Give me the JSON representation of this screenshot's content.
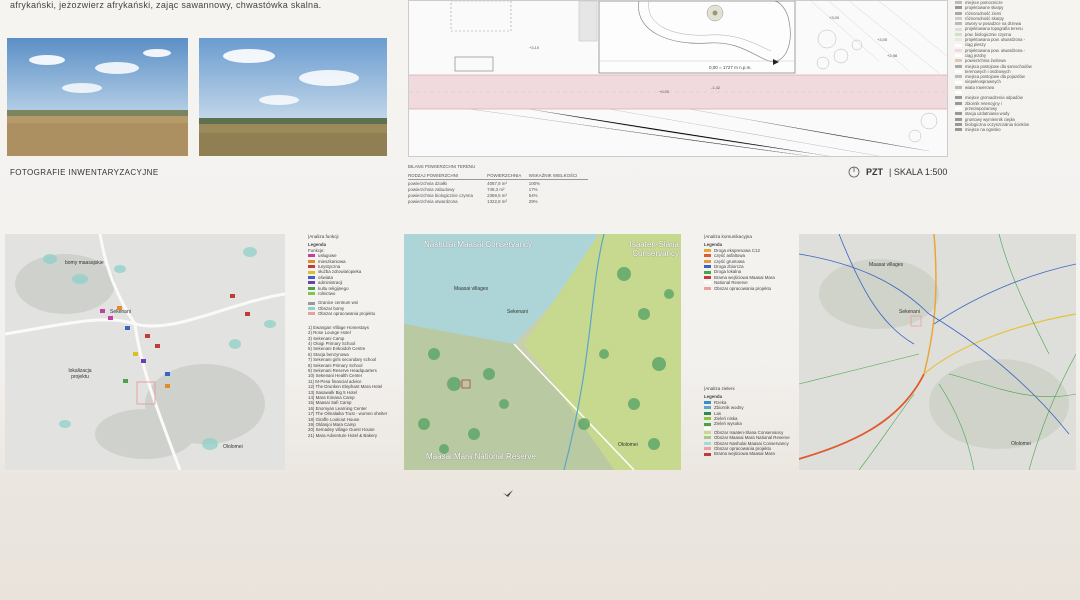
{
  "intro_text": "afrykański, jeżozwierz afrykański, zając sawannowy, chwastówka skalna.",
  "photos_caption": "FOTOGRAFIE INWENTARYZACYJNE",
  "plan_annotations": {
    "level_label": "0,00 = 1727 m n.p.m.",
    "dims": [
      "+3,05",
      "+2,98",
      "+3,00",
      "+3,10",
      "-1,42",
      "+0,00"
    ]
  },
  "legend_top": [
    {
      "label": "miejsce pomocnicze",
      "color": "#bbbbbb"
    },
    {
      "label": "projektowane skarpy",
      "color": "#999999"
    },
    {
      "label": "różnorodność ziemi",
      "color": "#aaaaaa"
    },
    {
      "label": "różnorodność skarpy",
      "color": "#cccccc"
    },
    {
      "label": "otwory w posadzce na drzewa",
      "color": "#bbbbbb"
    },
    {
      "label": "projektowana topografia terenu",
      "color": "#dddddd"
    },
    {
      "label": "pow. biologicznie czynna",
      "color": "#cfe3c4"
    },
    {
      "label": "projektowana pow. utwardzona -",
      "color": "#e6e6e6"
    },
    {
      "label": "ciąg pieszy",
      "color": "#ffffff"
    },
    {
      "label": "projektowana pow. utwardzona -",
      "color": "#f0d8dc"
    },
    {
      "label": "ciąg jezdny",
      "color": "#ffffff"
    },
    {
      "label": "powierzchnia żwirowa",
      "color": "#d9c9b8"
    },
    {
      "label": "miejsca postojowe dla samochodów",
      "color": "#aaaaaa"
    },
    {
      "label": "terenowych i osobowych",
      "color": "#ffffff"
    },
    {
      "label": "miejsca postojowe dla pojazdów",
      "color": "#bbbbbb"
    },
    {
      "label": "niepełnosprawnych",
      "color": "#ffffff"
    },
    {
      "label": "wiata rowerowa",
      "color": "#bbbbbb"
    },
    {
      "label": "",
      "color": "#ffffff"
    },
    {
      "label": "miejsce gromadzenia odpadów",
      "color": "#999999"
    },
    {
      "label": "zbiornik retencyjny i",
      "color": "#999999"
    },
    {
      "label": "przeciwpożarowy",
      "color": "#ffffff"
    },
    {
      "label": "stacja uzdatniania wody",
      "color": "#999999"
    },
    {
      "label": "gruntowy wymiennik ciepła",
      "color": "#999999"
    },
    {
      "label": "biologiczna oczyszczalnia ścieków",
      "color": "#999999"
    },
    {
      "label": "miejsce na ognisko",
      "color": "#999999"
    }
  ],
  "balance": {
    "title": "BILANS POWIERZCHNI TERENU",
    "headers": [
      "RODZAJ POWIERZCHNI",
      "POWIERZCHNIA",
      "WSKAŹNIK WIELKOŚCI"
    ],
    "rows": [
      [
        "powierzchnia działki",
        "4087,8 m²",
        "100%"
      ],
      [
        "powierzchnia zabudowy",
        "749,3 m²",
        "17%"
      ],
      [
        "powierzchnia biologicznie czynna",
        "2369,5 m²",
        "54%"
      ],
      [
        "powierzchnia utwardzona",
        "1322,8 m²",
        "29%"
      ]
    ]
  },
  "scale": {
    "code": "PZT",
    "text": "| SKALA 1:500"
  },
  "analysis_functions": {
    "title": "|Analiza funkcji",
    "legend_header": "Legenda",
    "functions_label": "Funkcje:",
    "items": [
      {
        "label": "usługowe",
        "color": "#c43fa3"
      },
      {
        "label": "mieszkaniowa",
        "color": "#e08c2b"
      },
      {
        "label": "turystyczna",
        "color": "#c23b3b"
      },
      {
        "label": "służba zdrowia/opieka",
        "color": "#d9c125"
      },
      {
        "label": "oświata",
        "color": "#3b64c2"
      },
      {
        "label": "administracji",
        "color": "#6b3fb0"
      },
      {
        "label": "kultu religijnego",
        "color": "#4aa34a"
      },
      {
        "label": "rolnictwo",
        "color": "#8bc34a"
      }
    ],
    "extra": [
      {
        "label": "Granice centrum wsi",
        "color": "#999999"
      },
      {
        "label": "Obszar bomy",
        "color": "#8fd0c8"
      },
      {
        "label": "Obszar opracowania projektu",
        "color": "#e8a0a0"
      }
    ],
    "places": [
      "1) Ewangan Village Homestays",
      "2) Rose Lounge Hotel",
      "3) Sekenani Camp",
      "4) Oloigi Primary School",
      "5) Sekenani Enkoidoh Centre",
      "6) Stacja benzynowa",
      "7) Sekenani girls secondary school",
      "8) Sekenani Primary School",
      "9) Sekenani Reserve Headquarters",
      "10) Sekenani Health Center",
      "11) M-Pesa financial advice",
      "12) The Drunken Elephant Mara Hotel",
      "13) Sasawalk Big 5 Hotel",
      "14) Mara Kimana Camp",
      "15) Maasai Safi Camp",
      "16) Enomyan Learning Center",
      "17) The Olmalaika Trust - women shelter",
      "18) Giraffe Lookout House",
      "19) Oldanjoi Mara Camp",
      "20) Semadey village Guest House",
      "21) Mara Adventure Hotel & Bakery"
    ]
  },
  "map1_labels": {
    "bomas": "bomy maasajskie",
    "town": "Sekenani",
    "location": "lokalizacja projektu",
    "ololomei": "Ololomei"
  },
  "map2_labels": {
    "north": "Nashulai Maasai Conservancy",
    "east": "Isaaten-Slana Conservancy",
    "south": "Maasai Mara National Reserve",
    "villages": "Maasai villages",
    "town": "Sekenani",
    "ololomei": "Ololomei"
  },
  "analysis_comm": {
    "title": "|Analiza komunikacyjna",
    "legend_header": "Legenda",
    "items": [
      {
        "label": "Droga ekspresowa C12",
        "color": "#e8a63a"
      },
      {
        "label": "część asfaltowa",
        "color": "#e05a2b"
      },
      {
        "label": "część gruntowa",
        "color": "#e89a3a"
      },
      {
        "label": "Droga zbiorcza",
        "color": "#3b64c2"
      },
      {
        "label": "Droga lokalna",
        "color": "#4aa34a"
      },
      {
        "label": "Brama wejściowa Maasai Mara",
        "color": "#c23b3b"
      },
      {
        "label": "National Reserve",
        "color": "#ffffff"
      },
      {
        "label": "Obszar opracowania projektu",
        "color": "#e8a0a0"
      }
    ]
  },
  "analysis_green": {
    "title": "|Analiza zieleni",
    "legend_header": "Legenda",
    "items": [
      {
        "label": "Rzeka",
        "color": "#3b8fc2"
      },
      {
        "label": "Zbiornik wodny",
        "color": "#5aa7c9"
      },
      {
        "label": "Las",
        "color": "#2f8a4a"
      },
      {
        "label": "Zieleń niska",
        "color": "#8bc34a"
      },
      {
        "label": "Zieleń wysoka",
        "color": "#4aa34a"
      },
      {
        "label": "",
        "color": "#ffffff"
      },
      {
        "label": "Obszar Isaaten-Slana Conservancy",
        "color": "#c7d98a"
      },
      {
        "label": "Obszar Maasai Mara National Reserve",
        "color": "#a6c98a"
      },
      {
        "label": "Obszar Nashulai Maasai Conservancy",
        "color": "#a8d6de"
      },
      {
        "label": "Obszar opracowania projektu",
        "color": "#e8a0a0"
      },
      {
        "label": "Brama wejściowa Maasai Mara",
        "color": "#c23b3b"
      }
    ]
  },
  "map3_labels": {
    "villages": "Maasai villages",
    "town": "Sekenani",
    "ololomei": "Ololomei"
  }
}
